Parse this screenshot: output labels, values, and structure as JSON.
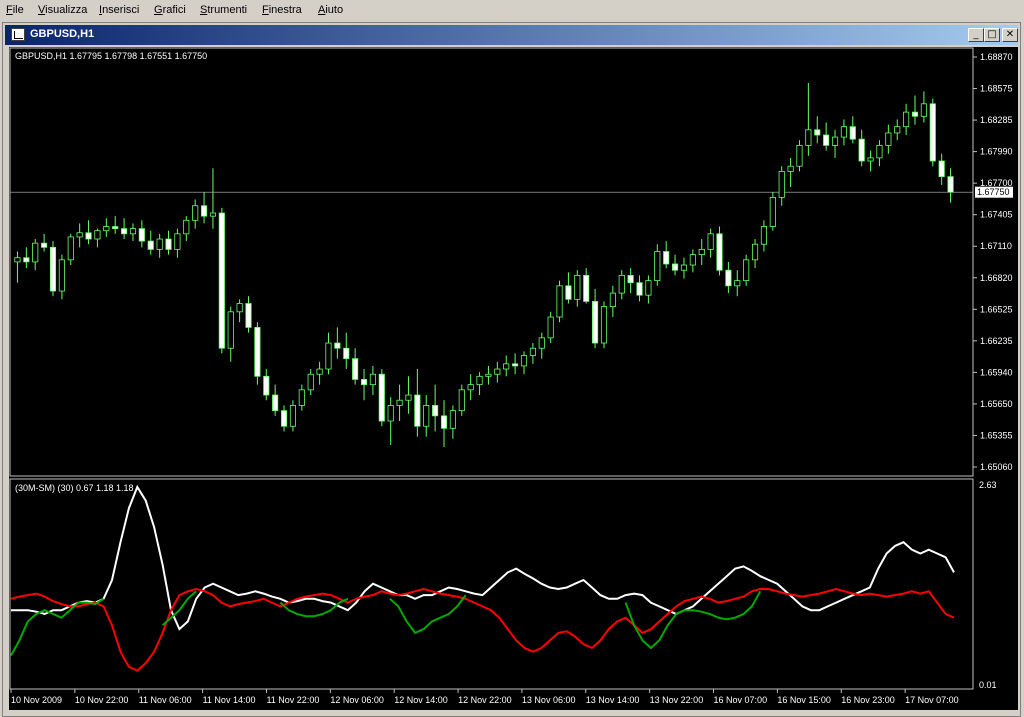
{
  "menu": {
    "items": [
      "File",
      "Visualizza",
      "Inserisci",
      "Grafici",
      "Strumenti",
      "Finestra",
      "Aiuto"
    ]
  },
  "window": {
    "title": "GBPUSD,H1",
    "icon": "chart-window-icon",
    "buttons": [
      {
        "name": "minimize",
        "glyph": "_"
      },
      {
        "name": "maximize",
        "glyph": "□"
      },
      {
        "name": "close",
        "glyph": "✕"
      }
    ]
  },
  "price_panel": {
    "header": "GBPUSD,H1  1.67795 1.67798 1.67551 1.67750",
    "current_price_label": "1.67750",
    "current_price": 1.6775,
    "y_ticks": [
      "1.68870",
      "1.68575",
      "1.68285",
      "1.67990",
      "1.67700",
      "1.67405",
      "1.67110",
      "1.66820",
      "1.66525",
      "1.66235",
      "1.65940",
      "1.65650",
      "1.65355",
      "1.65060"
    ]
  },
  "indicator_panel": {
    "header": "(30M-SM) (30) 0.67 1.18 1.18",
    "y_max_label": "2.63",
    "y_min_label": "0.01"
  },
  "x_axis": {
    "labels": [
      "10 Nov 2009",
      "10 Nov 22:00",
      "11 Nov 06:00",
      "11 Nov 14:00",
      "11 Nov 22:00",
      "12 Nov 06:00",
      "12 Nov 14:00",
      "12 Nov 22:00",
      "13 Nov 06:00",
      "13 Nov 14:00",
      "13 Nov 22:00",
      "16 Nov 07:00",
      "16 Nov 15:00",
      "16 Nov 23:00",
      "17 Nov 07:00"
    ]
  },
  "chart_data": [
    {
      "type": "candlestick",
      "symbol": "GBPUSD",
      "timeframe": "H1",
      "ylim": [
        1.6506,
        1.6905
      ],
      "colors": {
        "up": "#000000",
        "down": "#ffffff",
        "wick": "#66ff66",
        "background": "#000000"
      },
      "ohlc": [
        [
          1.6708,
          1.6718,
          1.6688,
          1.6712
        ],
        [
          1.6712,
          1.6722,
          1.6702,
          1.6708
        ],
        [
          1.6708,
          1.673,
          1.67,
          1.6726
        ],
        [
          1.6726,
          1.6735,
          1.6718,
          1.6722
        ],
        [
          1.6722,
          1.6728,
          1.6675,
          1.668
        ],
        [
          1.668,
          1.6715,
          1.6672,
          1.671
        ],
        [
          1.671,
          1.6735,
          1.6705,
          1.6732
        ],
        [
          1.6732,
          1.6745,
          1.6722,
          1.6736
        ],
        [
          1.6736,
          1.6748,
          1.6725,
          1.673
        ],
        [
          1.673,
          1.674,
          1.6722,
          1.6738
        ],
        [
          1.6738,
          1.675,
          1.6732,
          1.6742
        ],
        [
          1.6742,
          1.6752,
          1.6735,
          1.674
        ],
        [
          1.674,
          1.675,
          1.673,
          1.6735
        ],
        [
          1.6735,
          1.6745,
          1.6728,
          1.674
        ],
        [
          1.674,
          1.6748,
          1.6722,
          1.6728
        ],
        [
          1.6728,
          1.6738,
          1.6715,
          1.672
        ],
        [
          1.672,
          1.6735,
          1.6712,
          1.673
        ],
        [
          1.673,
          1.6738,
          1.6715,
          1.672
        ],
        [
          1.672,
          1.674,
          1.6712,
          1.6735
        ],
        [
          1.6735,
          1.6752,
          1.6728,
          1.6748
        ],
        [
          1.6748,
          1.6768,
          1.674,
          1.6762
        ],
        [
          1.6762,
          1.6775,
          1.6745,
          1.6752
        ],
        [
          1.6752,
          1.6798,
          1.674,
          1.6755
        ],
        [
          1.6755,
          1.676,
          1.662,
          1.6625
        ],
        [
          1.6625,
          1.6665,
          1.6612,
          1.666
        ],
        [
          1.666,
          1.6672,
          1.665,
          1.6668
        ],
        [
          1.6668,
          1.6675,
          1.664,
          1.6645
        ],
        [
          1.6645,
          1.665,
          1.659,
          1.6598
        ],
        [
          1.6598,
          1.6605,
          1.6575,
          1.658
        ],
        [
          1.658,
          1.659,
          1.656,
          1.6565
        ],
        [
          1.6565,
          1.657,
          1.6545,
          1.655
        ],
        [
          1.655,
          1.6575,
          1.6545,
          1.657
        ],
        [
          1.657,
          1.659,
          1.6565,
          1.6585
        ],
        [
          1.6585,
          1.6605,
          1.658,
          1.66
        ],
        [
          1.66,
          1.6612,
          1.659,
          1.6605
        ],
        [
          1.6605,
          1.664,
          1.66,
          1.663
        ],
        [
          1.663,
          1.6645,
          1.6615,
          1.6625
        ],
        [
          1.6625,
          1.664,
          1.6605,
          1.6615
        ],
        [
          1.6615,
          1.6625,
          1.659,
          1.6595
        ],
        [
          1.6595,
          1.6605,
          1.6575,
          1.659
        ],
        [
          1.659,
          1.6608,
          1.658,
          1.66
        ],
        [
          1.66,
          1.6605,
          1.655,
          1.6555
        ],
        [
          1.6555,
          1.6578,
          1.6532,
          1.657
        ],
        [
          1.657,
          1.659,
          1.6555,
          1.6575
        ],
        [
          1.6575,
          1.6598,
          1.6562,
          1.658
        ],
        [
          1.658,
          1.6605,
          1.654,
          1.655
        ],
        [
          1.655,
          1.658,
          1.654,
          1.657
        ],
        [
          1.657,
          1.659,
          1.6545,
          1.656
        ],
        [
          1.656,
          1.6575,
          1.653,
          1.6548
        ],
        [
          1.6548,
          1.657,
          1.6538,
          1.6565
        ],
        [
          1.6565,
          1.659,
          1.656,
          1.6585
        ],
        [
          1.6585,
          1.66,
          1.6575,
          1.659
        ],
        [
          1.659,
          1.6602,
          1.658,
          1.6598
        ],
        [
          1.6598,
          1.6608,
          1.659,
          1.66
        ],
        [
          1.66,
          1.6612,
          1.6592,
          1.6605
        ],
        [
          1.6605,
          1.6618,
          1.6598,
          1.661
        ],
        [
          1.661,
          1.662,
          1.66,
          1.6608
        ],
        [
          1.6608,
          1.6622,
          1.66,
          1.6618
        ],
        [
          1.6618,
          1.663,
          1.661,
          1.6625
        ],
        [
          1.6625,
          1.664,
          1.6615,
          1.6635
        ],
        [
          1.6635,
          1.666,
          1.663,
          1.6655
        ],
        [
          1.6655,
          1.669,
          1.665,
          1.6685
        ],
        [
          1.6685,
          1.6698,
          1.6668,
          1.6672
        ],
        [
          1.6672,
          1.67,
          1.6665,
          1.6695
        ],
        [
          1.6695,
          1.6702,
          1.6668,
          1.667
        ],
        [
          1.667,
          1.6682,
          1.6625,
          1.663
        ],
        [
          1.663,
          1.667,
          1.6625,
          1.6665
        ],
        [
          1.6665,
          1.6685,
          1.6655,
          1.6678
        ],
        [
          1.6678,
          1.67,
          1.6672,
          1.6695
        ],
        [
          1.6695,
          1.6702,
          1.6678,
          1.6688
        ],
        [
          1.6688,
          1.6695,
          1.667,
          1.6676
        ],
        [
          1.6676,
          1.6695,
          1.6668,
          1.669
        ],
        [
          1.669,
          1.6725,
          1.6685,
          1.6718
        ],
        [
          1.6718,
          1.6728,
          1.6702,
          1.6706
        ],
        [
          1.6706,
          1.6715,
          1.6695,
          1.67
        ],
        [
          1.67,
          1.6712,
          1.6692,
          1.6705
        ],
        [
          1.6705,
          1.672,
          1.6698,
          1.6715
        ],
        [
          1.6715,
          1.673,
          1.6705,
          1.672
        ],
        [
          1.672,
          1.674,
          1.6712,
          1.6735
        ],
        [
          1.6735,
          1.6742,
          1.6695,
          1.67
        ],
        [
          1.67,
          1.6708,
          1.6678,
          1.6685
        ],
        [
          1.6685,
          1.67,
          1.6675,
          1.669
        ],
        [
          1.669,
          1.6715,
          1.6685,
          1.671
        ],
        [
          1.671,
          1.673,
          1.6702,
          1.6725
        ],
        [
          1.6725,
          1.6748,
          1.6718,
          1.6742
        ],
        [
          1.6742,
          1.6775,
          1.6738,
          1.677
        ],
        [
          1.677,
          1.68,
          1.6762,
          1.6795
        ],
        [
          1.6795,
          1.6808,
          1.678,
          1.68
        ],
        [
          1.68,
          1.6825,
          1.6795,
          1.682
        ],
        [
          1.682,
          1.688,
          1.681,
          1.6835
        ],
        [
          1.6835,
          1.6848,
          1.6822,
          1.683
        ],
        [
          1.683,
          1.6842,
          1.6815,
          1.682
        ],
        [
          1.682,
          1.6835,
          1.6808,
          1.6828
        ],
        [
          1.6828,
          1.6845,
          1.682,
          1.6838
        ],
        [
          1.6838,
          1.6848,
          1.6822,
          1.6826
        ],
        [
          1.6826,
          1.6835,
          1.68,
          1.6805
        ],
        [
          1.6805,
          1.6815,
          1.6795,
          1.6808
        ],
        [
          1.6808,
          1.6825,
          1.68,
          1.682
        ],
        [
          1.682,
          1.684,
          1.6812,
          1.6832
        ],
        [
          1.6832,
          1.6845,
          1.6825,
          1.6838
        ],
        [
          1.6838,
          1.686,
          1.683,
          1.6852
        ],
        [
          1.6852,
          1.6868,
          1.684,
          1.6848
        ],
        [
          1.6848,
          1.6872,
          1.6842,
          1.686
        ],
        [
          1.686,
          1.6865,
          1.68,
          1.6805
        ],
        [
          1.6805,
          1.6812,
          1.6782,
          1.679
        ],
        [
          1.679,
          1.6798,
          1.6765,
          1.6775
        ]
      ]
    },
    {
      "type": "line",
      "title": "(30M-SM) (30) 0.67 1.18 1.18",
      "ylim": [
        0.01,
        2.63
      ],
      "series": [
        {
          "color": "#ffffff",
          "values": [
            1.0,
            1.0,
            1.0,
            0.98,
            0.95,
            1.0,
            1.0,
            1.05,
            1.1,
            1.12,
            1.1,
            1.15,
            1.4,
            1.9,
            2.35,
            2.63,
            2.45,
            2.1,
            1.6,
            1.0,
            0.75,
            0.85,
            1.15,
            1.3,
            1.35,
            1.3,
            1.25,
            1.2,
            1.22,
            1.25,
            1.22,
            1.18,
            1.15,
            1.1,
            1.12,
            1.15,
            1.15,
            1.12,
            1.1,
            1.05,
            1.0,
            1.1,
            1.25,
            1.35,
            1.3,
            1.25,
            1.2,
            1.2,
            1.15,
            1.2,
            1.2,
            1.25,
            1.3,
            1.28,
            1.25,
            1.22,
            1.2,
            1.3,
            1.4,
            1.5,
            1.55,
            1.48,
            1.42,
            1.35,
            1.3,
            1.28,
            1.3,
            1.35,
            1.4,
            1.3,
            1.2,
            1.15,
            1.15,
            1.2,
            1.22,
            1.2,
            1.1,
            1.05,
            1.0,
            0.95,
            1.0,
            1.05,
            1.15,
            1.25,
            1.35,
            1.45,
            1.55,
            1.58,
            1.52,
            1.45,
            1.4,
            1.35,
            1.25,
            1.15,
            1.05,
            1.0,
            1.0,
            1.05,
            1.1,
            1.15,
            1.2,
            1.25,
            1.3,
            1.55,
            1.75,
            1.85,
            1.9,
            1.8,
            1.75,
            1.8,
            1.75,
            1.7,
            1.5
          ]
        },
        {
          "color": "#ff0000",
          "values": [
            1.15,
            1.18,
            1.2,
            1.22,
            1.18,
            1.12,
            1.08,
            1.05,
            1.05,
            1.08,
            1.1,
            1.05,
            0.8,
            0.45,
            0.25,
            0.2,
            0.3,
            0.45,
            0.7,
            1.0,
            1.2,
            1.25,
            1.28,
            1.25,
            1.2,
            1.1,
            1.05,
            1.08,
            1.1,
            1.12,
            1.15,
            1.1,
            1.05,
            1.1,
            1.15,
            1.18,
            1.2,
            1.22,
            1.2,
            1.15,
            1.1,
            1.15,
            1.18,
            1.2,
            1.25,
            1.22,
            1.2,
            1.22,
            1.25,
            1.28,
            1.25,
            1.22,
            1.2,
            1.18,
            1.15,
            1.1,
            1.05,
            1.0,
            0.9,
            0.75,
            0.6,
            0.5,
            0.45,
            0.5,
            0.6,
            0.7,
            0.72,
            0.65,
            0.55,
            0.5,
            0.6,
            0.75,
            0.85,
            0.9,
            0.8,
            0.7,
            0.75,
            0.85,
            0.95,
            1.05,
            1.12,
            1.15,
            1.18,
            1.15,
            1.1,
            1.12,
            1.15,
            1.18,
            1.25,
            1.28,
            1.28,
            1.25,
            1.22,
            1.2,
            1.18,
            1.2,
            1.22,
            1.25,
            1.28,
            1.25,
            1.22,
            1.2,
            1.22,
            1.2,
            1.18,
            1.2,
            1.22,
            1.25,
            1.22,
            1.25,
            1.1,
            0.95,
            0.9
          ]
        },
        {
          "color": "#00aa00",
          "values": [
            0.4,
            0.6,
            0.85,
            0.95,
            1.0,
            0.95,
            0.9,
            1.0,
            1.1,
            1.1,
            1.08,
            1.15,
            null,
            null,
            null,
            null,
            null,
            null,
            0.8,
            0.9,
            1.0,
            1.15,
            1.25,
            null,
            null,
            null,
            null,
            null,
            null,
            null,
            null,
            null,
            1.1,
            1.0,
            0.95,
            0.92,
            0.92,
            0.95,
            1.0,
            1.1,
            1.15,
            null,
            null,
            null,
            null,
            1.15,
            1.05,
            0.85,
            0.7,
            0.75,
            0.85,
            0.9,
            0.95,
            1.05,
            1.2,
            null,
            null,
            null,
            null,
            null,
            null,
            null,
            null,
            null,
            null,
            null,
            null,
            null,
            null,
            null,
            null,
            null,
            null,
            1.1,
            0.8,
            0.6,
            0.5,
            0.6,
            0.8,
            0.95,
            1.0,
            1.0,
            0.98,
            0.95,
            0.9,
            0.88,
            0.9,
            0.95,
            1.05,
            1.25,
            null,
            null,
            null,
            null,
            null,
            null,
            null,
            null,
            null,
            null,
            null,
            null,
            null,
            null,
            null,
            null,
            null,
            null,
            null,
            null,
            null,
            null,
            null
          ]
        }
      ]
    }
  ]
}
